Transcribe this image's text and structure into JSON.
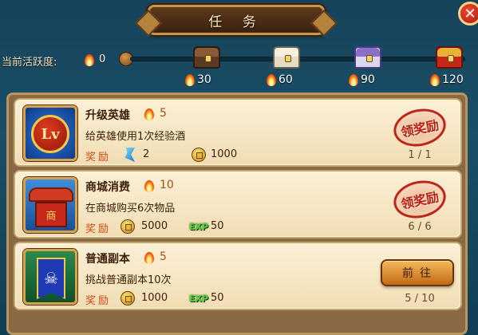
{
  "title": "任 务",
  "close_label": "✕",
  "activity": {
    "label": "当前活跃度:",
    "value": "0",
    "milestones": [
      {
        "value": "30",
        "chest": "brown-chest-icon"
      },
      {
        "value": "60",
        "chest": "white-chest-icon"
      },
      {
        "value": "90",
        "chest": "purple-chest-icon"
      },
      {
        "value": "120",
        "chest": "red-gold-chest-icon"
      }
    ]
  },
  "tasks": [
    {
      "name": "升级英雄",
      "activity": "5",
      "icon": "level-up-icon",
      "icon_text": "Lv",
      "desc": "给英雄使用1次经验酒",
      "reward_label": "奖励",
      "rewards": [
        {
          "type": "gem",
          "value": "2"
        },
        {
          "type": "coin",
          "value": "1000"
        }
      ],
      "status": "stamp",
      "stamp_text": "领奖励",
      "progress": "1 / 1"
    },
    {
      "name": "商城消费",
      "activity": "10",
      "icon": "shop-icon",
      "icon_text": "商",
      "desc": "在商城购买6次物品",
      "reward_label": "奖励",
      "rewards": [
        {
          "type": "coin",
          "value": "5000"
        },
        {
          "type": "exp",
          "label": "EXP",
          "value": "50"
        }
      ],
      "status": "stamp",
      "stamp_text": "领奖励",
      "progress": "6 / 6"
    },
    {
      "name": "普通副本",
      "activity": "5",
      "icon": "dungeon-banner-icon",
      "icon_text": "☠",
      "desc": "挑战普通副本10次",
      "reward_label": "奖励",
      "rewards": [
        {
          "type": "coin",
          "value": "1000"
        },
        {
          "type": "exp",
          "label": "EXP",
          "value": "50"
        }
      ],
      "status": "button",
      "button_label": "前往",
      "progress": "5 / 10"
    }
  ]
}
